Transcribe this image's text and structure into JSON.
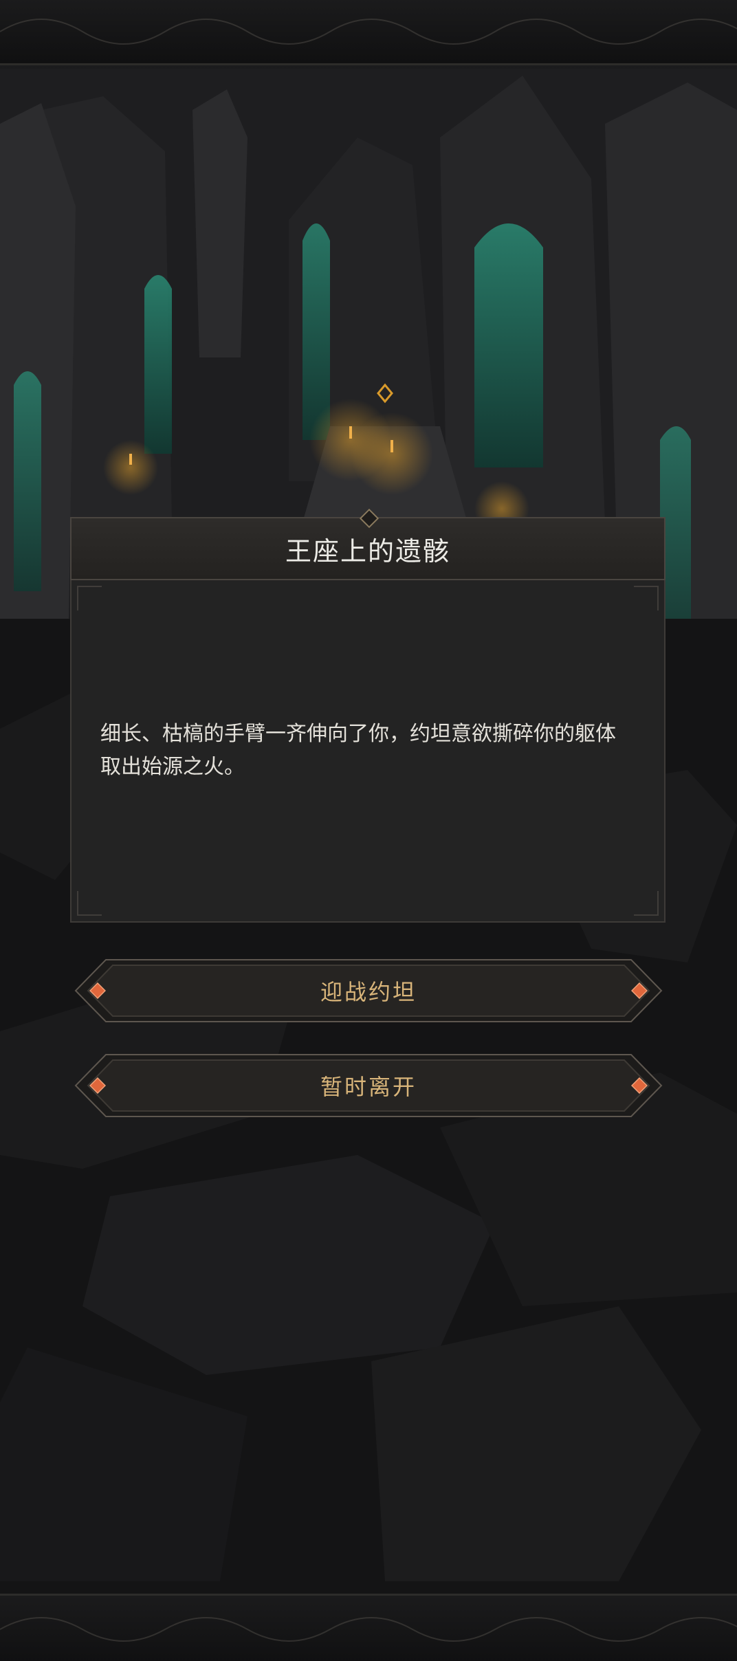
{
  "event": {
    "title": "王座上的遗骸",
    "description": "细长、枯槁的手臂一齐伸向了你，约坦意欲撕碎你的躯体取出始源之火。"
  },
  "choices": [
    {
      "label": "迎战约坦"
    },
    {
      "label": "暂时离开"
    }
  ],
  "colors": {
    "dialog_body": "#232323",
    "dialog_header": "#2e2c2a",
    "choice_text": "#d9b57a",
    "gem": "#e0673c",
    "stained_glass": "#1f6b5c",
    "candle": "#d99a2b"
  },
  "icons": {
    "choice_marker": "diamond-gem-icon",
    "header_marker": "diamond-ornament-icon"
  }
}
